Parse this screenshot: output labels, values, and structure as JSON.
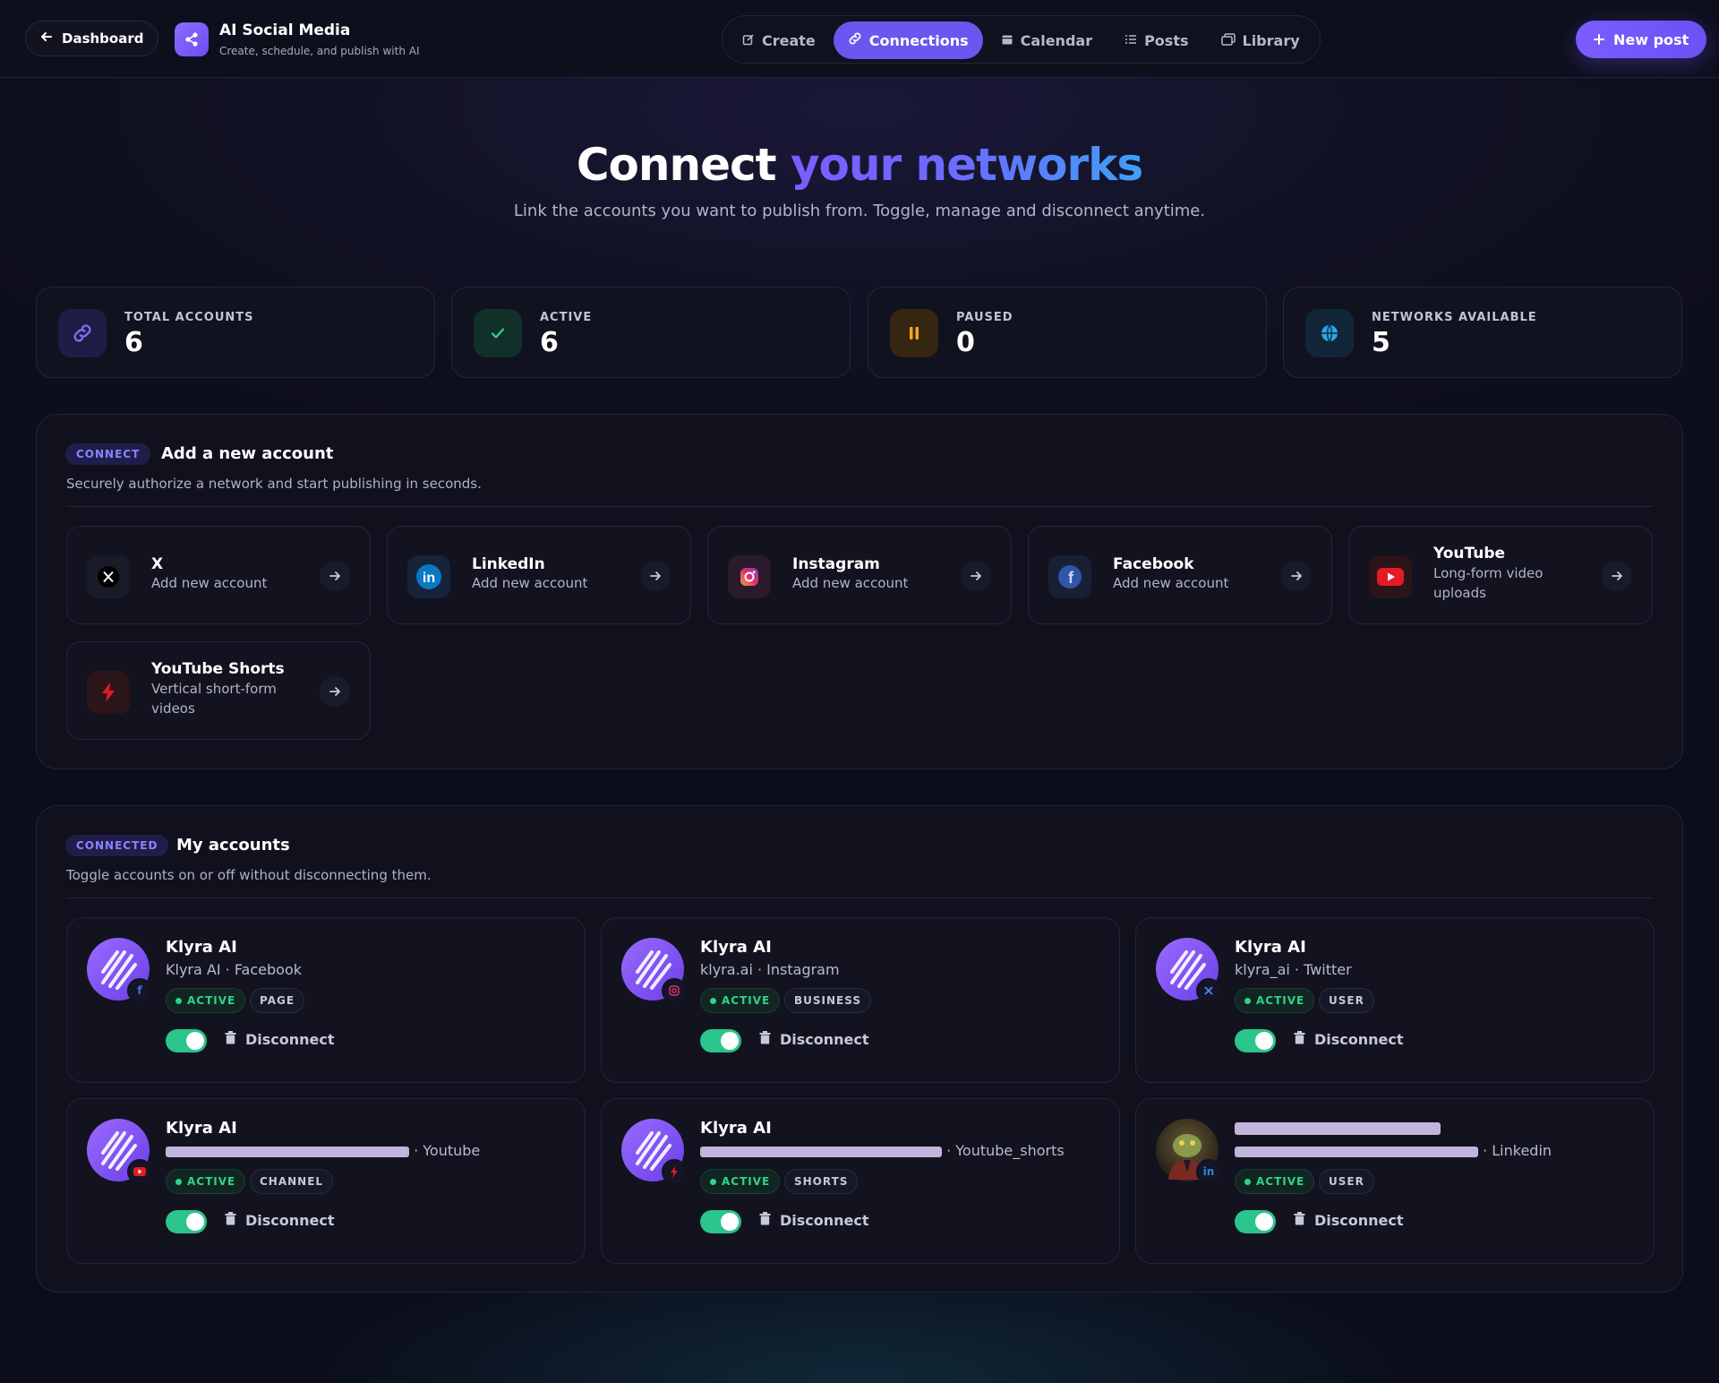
{
  "nav": {
    "back_label": "Dashboard",
    "brand_title": "AI Social Media",
    "brand_subtitle": "Create, schedule, and publish with AI",
    "tabs": [
      {
        "label": "Create",
        "icon": "edit-icon",
        "active": false
      },
      {
        "label": "Connections",
        "icon": "link-icon",
        "active": true
      },
      {
        "label": "Calendar",
        "icon": "calendar-icon",
        "active": false
      },
      {
        "label": "Posts",
        "icon": "list-icon",
        "active": false
      },
      {
        "label": "Library",
        "icon": "library-icon",
        "active": false
      }
    ],
    "new_post_label": "New post"
  },
  "hero": {
    "title_plain": "Connect",
    "title_accent": "your networks",
    "subtitle": "Link the accounts you want to publish from. Toggle, manage and disconnect anytime."
  },
  "stats": [
    {
      "label": "TOTAL ACCOUNTS",
      "value": "6",
      "icon": "link-icon",
      "color": "#6b5cff"
    },
    {
      "label": "ACTIVE",
      "value": "6",
      "icon": "check-icon",
      "color": "#2fd38b"
    },
    {
      "label": "PAUSED",
      "value": "0",
      "icon": "pause-icon",
      "color": "#f5a623"
    },
    {
      "label": "NETWORKS AVAILABLE",
      "value": "5",
      "icon": "globe-icon",
      "color": "#2aa8e8"
    }
  ],
  "connect_panel": {
    "badge": "CONNECT",
    "title": "Add a new account",
    "subtitle": "Securely authorize a network and start publishing in seconds.",
    "networks": [
      {
        "name": "X",
        "desc": "Add new account",
        "icon": "x-icon"
      },
      {
        "name": "LinkedIn",
        "desc": "Add new account",
        "icon": "linkedin-icon"
      },
      {
        "name": "Instagram",
        "desc": "Add new account",
        "icon": "instagram-icon"
      },
      {
        "name": "Facebook",
        "desc": "Add new account",
        "icon": "facebook-icon"
      },
      {
        "name": "YouTube",
        "desc": "Long-form video uploads",
        "icon": "youtube-icon"
      },
      {
        "name": "YouTube Shorts",
        "desc": "Vertical short-form videos",
        "icon": "shorts-icon"
      }
    ]
  },
  "accounts_panel": {
    "badge": "CONNECTED",
    "title": "My accounts",
    "subtitle": "Toggle accounts on or off without disconnecting them.",
    "disconnect_label": "Disconnect",
    "accounts": [
      {
        "name": "Klyra AI",
        "handle": "Klyra AI",
        "network": "Facebook",
        "status": "ACTIVE",
        "type": "PAGE",
        "badge_icon": "facebook-icon",
        "enabled": true
      },
      {
        "name": "Klyra AI",
        "handle": "klyra.ai",
        "network": "Instagram",
        "status": "ACTIVE",
        "type": "BUSINESS",
        "badge_icon": "instagram-icon",
        "enabled": true
      },
      {
        "name": "Klyra AI",
        "handle": "klyra_ai",
        "network": "Twitter",
        "status": "ACTIVE",
        "type": "USER",
        "badge_icon": "x-icon",
        "enabled": true
      },
      {
        "name": "Klyra AI",
        "handle": "",
        "network": "Youtube",
        "status": "ACTIVE",
        "type": "CHANNEL",
        "badge_icon": "youtube-icon",
        "enabled": true
      },
      {
        "name": "Klyra AI",
        "handle": "",
        "network": "Youtube_shorts",
        "status": "ACTIVE",
        "type": "SHORTS",
        "badge_icon": "shorts-icon",
        "enabled": true
      },
      {
        "name": "",
        "handle": "",
        "network": "Linkedin",
        "status": "ACTIVE",
        "type": "USER",
        "badge_icon": "linkedin-icon",
        "enabled": true
      }
    ]
  }
}
